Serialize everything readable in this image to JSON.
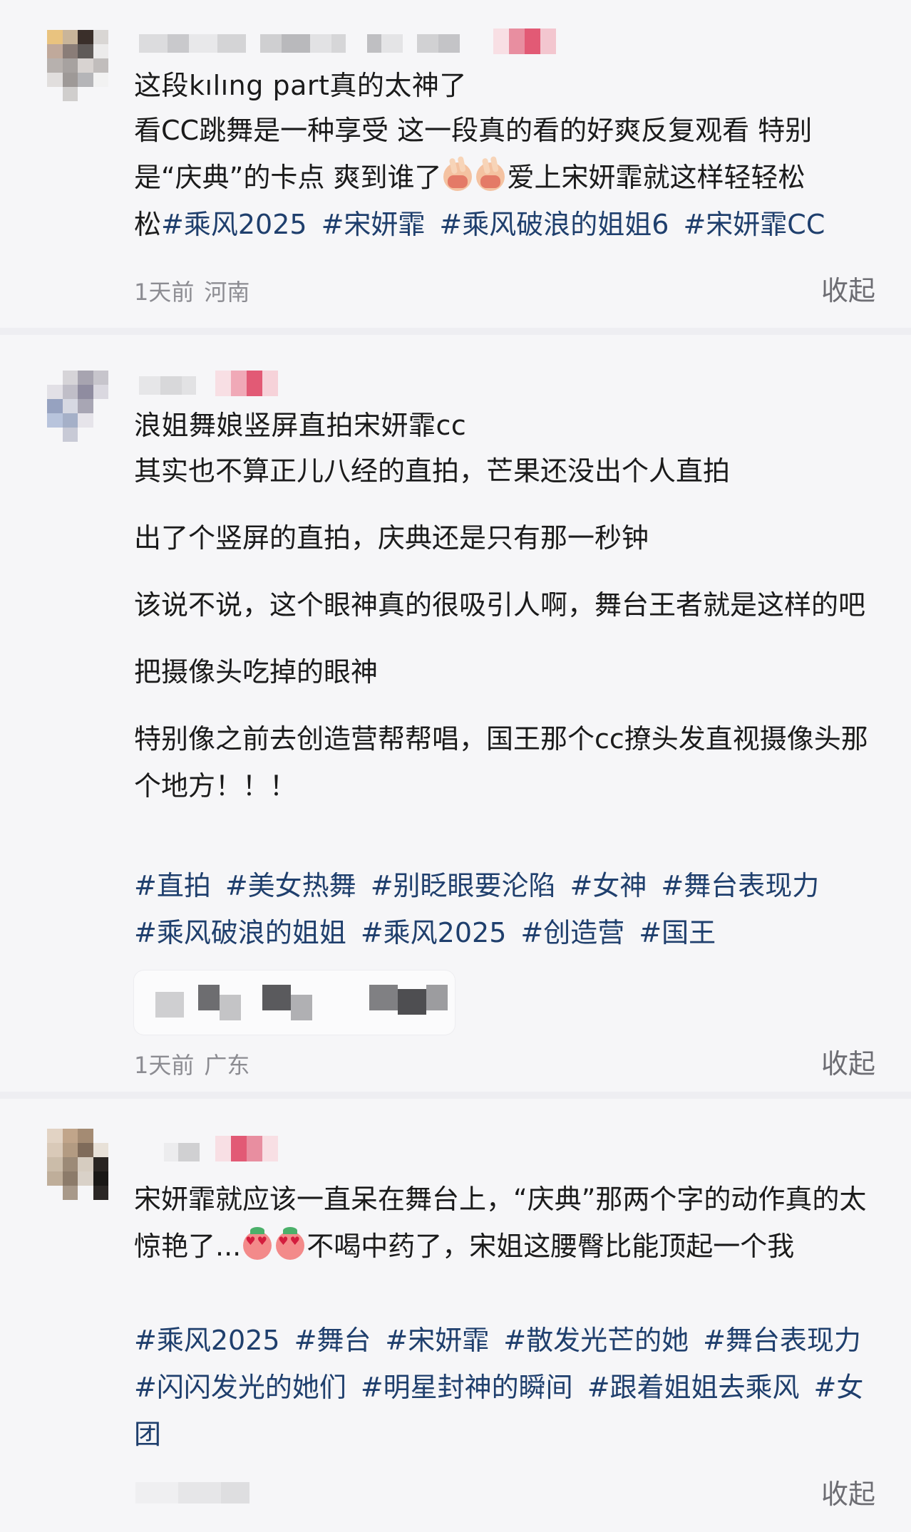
{
  "posts": [
    {
      "title": "这段kılıng part真的太神了",
      "body_lines": [
        [
          "看CC跳舞是一种享受 这一段真的看的好爽反复观看 特别"
        ],
        [
          "是“庆典”的卡点 爽到谁了",
          "爱上宋妍霏就这样轻轻松"
        ],
        [
          "松"
        ]
      ],
      "tags_line1": [
        "#乘风2025",
        "#宋妍霏",
        "#乘风破浪的姐姐6",
        "#宋妍霏CC"
      ],
      "time": "1天前",
      "location": "河南",
      "collapse": "收起"
    },
    {
      "title": "浪姐舞娘竖屏直拍宋妍霏cc",
      "paragraphs": [
        "其实也不算正儿八经的直拍，芒果还没出个人直拍",
        "出了个竖屏的直拍，庆典还是只有那一秒钟",
        "该说不说，这个眼神真的很吸引人啊，舞台王者就是这样的吧",
        "把摄像头吃掉的眼神",
        "特别像之前去创造营帮帮唱，国王那个cc撩头发直视摄像头那个地方！！！"
      ],
      "tags": [
        "#直拍",
        "#美女热舞",
        "#别眨眼要沦陷",
        "#女神",
        "#舞台表现力",
        "#乘风破浪的姐姐",
        "#乘风2025",
        "#创造营",
        "#国王"
      ],
      "time": "1天前",
      "location": "广东",
      "collapse": "收起"
    },
    {
      "body_part1": "宋妍霏就应该一直呆在舞台上，“庆典”那两个字的动作真的太惊艳了...",
      "body_part2": "不喝中药了，宋姐这腰臀比能顶起一个我",
      "tags": [
        "#乘风2025",
        "#舞台",
        "#宋妍霏",
        "#散发光芒的她",
        "#舞台表现力",
        "#闪闪发光的她们",
        "#明星封神的瞬间",
        "#跟着姐姐去乘风",
        "#女团"
      ],
      "collapse": "收起"
    }
  ],
  "colors": {
    "hashtag": "#1f3f6d",
    "meta": "#8c8c92",
    "background": "#f6f6f8"
  },
  "icons": [
    "peace-hand-emoji",
    "heart-eyes-emoji"
  ]
}
